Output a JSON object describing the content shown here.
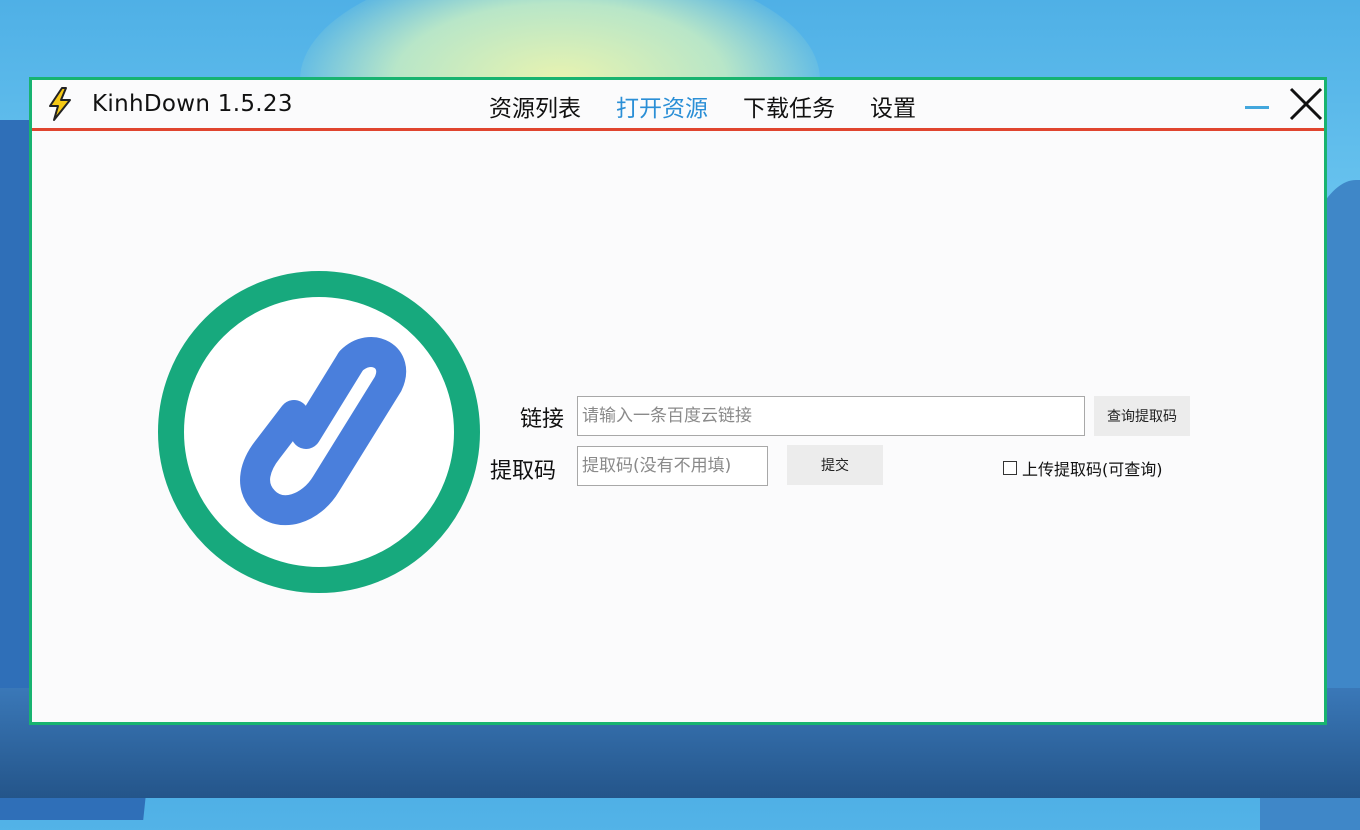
{
  "window": {
    "title": "KinhDown 1.5.23",
    "icon": "lightning-bolt-icon",
    "accent_color": "#18b370",
    "titlebar_underline_color": "#e0452f"
  },
  "nav": {
    "items": [
      {
        "label": "资源列表",
        "active": false
      },
      {
        "label": "打开资源",
        "active": true
      },
      {
        "label": "下载任务",
        "active": false
      },
      {
        "label": "设置",
        "active": false
      }
    ],
    "active_color": "#2b8fd6"
  },
  "form": {
    "link_label": "链接",
    "link_placeholder": "请输入一条百度云链接",
    "link_value": "",
    "query_button": "查询提取码",
    "code_label": "提取码",
    "code_placeholder": "提取码(没有不用填)",
    "code_value": "",
    "submit_button": "提交",
    "upload_checkbox_label": "上传提取码(可查询)",
    "upload_checked": false
  },
  "logo": {
    "icon": "link-icon",
    "ring_color": "#17a97d",
    "link_color": "#4a7fdc"
  }
}
